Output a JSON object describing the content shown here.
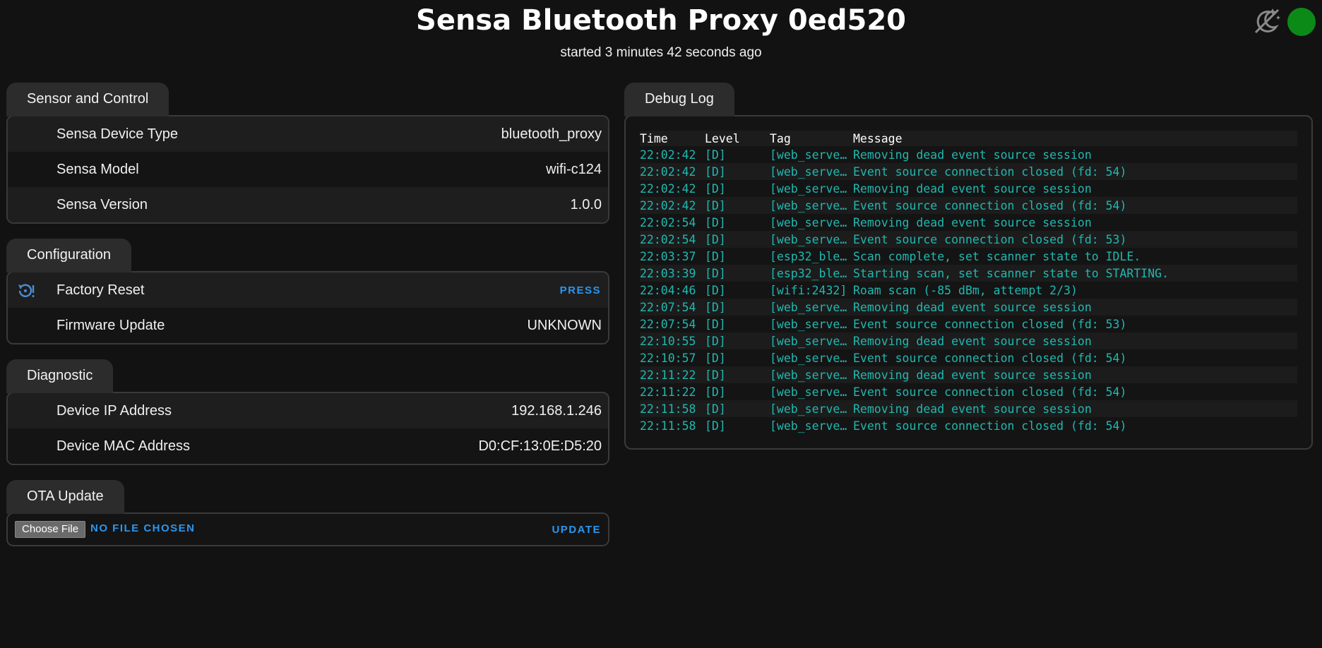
{
  "header": {
    "title": "Sensa Bluetooth Proxy 0ed520",
    "subtitle": "started 3 minutes 42 seconds ago",
    "status_color": "#0b8a17",
    "theme_icon": "theme-toggle-icon"
  },
  "sensor": {
    "tab": "Sensor and Control",
    "rows": [
      {
        "label": "Sensa Device Type",
        "value": "bluetooth_proxy"
      },
      {
        "label": "Sensa Model",
        "value": "wifi-c124"
      },
      {
        "label": "Sensa Version",
        "value": "1.0.0"
      }
    ]
  },
  "configuration": {
    "tab": "Configuration",
    "factory_reset": {
      "label": "Factory Reset",
      "action": "PRESS",
      "icon": "restart-alert-icon"
    },
    "firmware": {
      "label": "Firmware Update",
      "value": "UNKNOWN"
    }
  },
  "diagnostic": {
    "tab": "Diagnostic",
    "rows": [
      {
        "label": "Device IP Address",
        "value": "192.168.1.246"
      },
      {
        "label": "Device MAC Address",
        "value": "D0:CF:13:0E:D5:20"
      }
    ]
  },
  "ota": {
    "tab": "OTA Update",
    "choose_file": "Choose File",
    "no_file": "NO FILE CHOSEN",
    "update": "UPDATE"
  },
  "debug": {
    "tab": "Debug Log",
    "headers": {
      "time": "Time",
      "level": "Level",
      "tag": "Tag",
      "message": "Message"
    },
    "entries": [
      {
        "time": "22:02:42",
        "level": "[D]",
        "tag": "[web_server…",
        "message": "Removing dead event source session"
      },
      {
        "time": "22:02:42",
        "level": "[D]",
        "tag": "[web_server…",
        "message": "Event source connection closed (fd: 54)"
      },
      {
        "time": "22:02:42",
        "level": "[D]",
        "tag": "[web_server…",
        "message": "Removing dead event source session"
      },
      {
        "time": "22:02:42",
        "level": "[D]",
        "tag": "[web_server…",
        "message": "Event source connection closed (fd: 54)"
      },
      {
        "time": "22:02:54",
        "level": "[D]",
        "tag": "[web_server…",
        "message": "Removing dead event source session"
      },
      {
        "time": "22:02:54",
        "level": "[D]",
        "tag": "[web_server…",
        "message": "Event source connection closed (fd: 53)"
      },
      {
        "time": "22:03:37",
        "level": "[D]",
        "tag": "[esp32_ble_…",
        "message": "Scan complete, set scanner state to IDLE."
      },
      {
        "time": "22:03:39",
        "level": "[D]",
        "tag": "[esp32_ble_…",
        "message": "Starting scan, set scanner state to STARTING."
      },
      {
        "time": "22:04:46",
        "level": "[D]",
        "tag": "[wifi:2432]",
        "message": "Roam scan (-85 dBm, attempt 2/3)"
      },
      {
        "time": "22:07:54",
        "level": "[D]",
        "tag": "[web_server…",
        "message": "Removing dead event source session"
      },
      {
        "time": "22:07:54",
        "level": "[D]",
        "tag": "[web_server…",
        "message": "Event source connection closed (fd: 53)"
      },
      {
        "time": "22:10:55",
        "level": "[D]",
        "tag": "[web_server…",
        "message": "Removing dead event source session"
      },
      {
        "time": "22:10:57",
        "level": "[D]",
        "tag": "[web_server…",
        "message": "Event source connection closed (fd: 54)"
      },
      {
        "time": "22:11:22",
        "level": "[D]",
        "tag": "[web_server…",
        "message": "Removing dead event source session"
      },
      {
        "time": "22:11:22",
        "level": "[D]",
        "tag": "[web_server…",
        "message": "Event source connection closed (fd: 54)"
      },
      {
        "time": "22:11:58",
        "level": "[D]",
        "tag": "[web_server…",
        "message": "Removing dead event source session"
      },
      {
        "time": "22:11:58",
        "level": "[D]",
        "tag": "[web_server…",
        "message": "Event source connection closed (fd: 54)"
      }
    ]
  }
}
